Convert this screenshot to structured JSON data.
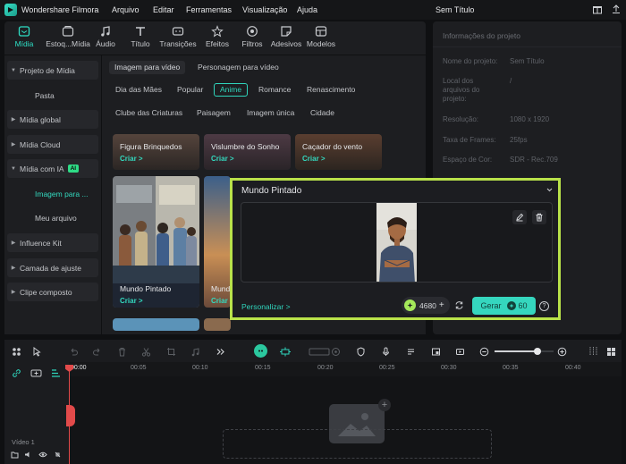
{
  "app": {
    "name": "Wondershare Filmora",
    "menu": [
      "Arquivo",
      "Editar",
      "Ferramentas",
      "Visualização",
      "Ajuda"
    ],
    "project_title": "Sem Título"
  },
  "toolbar": {
    "tabs": [
      {
        "label": "Mídia",
        "icon": "media-icon",
        "active": true
      },
      {
        "label": "Estoq...Mídia",
        "icon": "stock-media-icon"
      },
      {
        "label": "Áudio",
        "icon": "music-note-icon"
      },
      {
        "label": "Título",
        "icon": "text-t-icon"
      },
      {
        "label": "Transições",
        "icon": "transitions-icon"
      },
      {
        "label": "Efeitos",
        "icon": "effects-icon"
      },
      {
        "label": "Filtros",
        "icon": "filters-icon"
      },
      {
        "label": "Adesivos",
        "icon": "stickers-icon"
      },
      {
        "label": "Modelos",
        "icon": "templates-icon"
      }
    ]
  },
  "sidebar": {
    "items": [
      {
        "label": "Projeto de Mídia",
        "type": "group"
      },
      {
        "label": "Pasta",
        "type": "sub"
      },
      {
        "label": "Mídia global",
        "type": "group"
      },
      {
        "label": "Mídia Cloud",
        "type": "group"
      },
      {
        "label": "Mídia com IA",
        "type": "group-open",
        "badge": "AI"
      },
      {
        "label": "Imagem para ...",
        "type": "sub-selected"
      },
      {
        "label": "Meu arquivo",
        "type": "sub"
      },
      {
        "label": "Influence Kit",
        "type": "group"
      },
      {
        "label": "Camada de ajuste",
        "type": "group"
      },
      {
        "label": "Clipe composto",
        "type": "group"
      }
    ]
  },
  "content": {
    "mode_tabs": [
      "Imagem para vídeo",
      "Personagem para vídeo"
    ],
    "filters_row1": [
      "Dia das Mães",
      "Popular",
      "Anime",
      "Romance",
      "Renascimento"
    ],
    "filters_row2": [
      "Clube das Criaturas",
      "Paisagem",
      "Imagem única",
      "Cidade"
    ],
    "selected_filter": "Anime",
    "cards_top": [
      {
        "title": "Figura Brinquedos",
        "action": "Criar >"
      },
      {
        "title": "Vislumbre do Sonho",
        "action": "Criar >"
      },
      {
        "title": "Caçador do vento",
        "action": "Criar >"
      }
    ],
    "card_main": {
      "title": "Mundo Pintado",
      "action": "Criar >"
    },
    "card_partial": {
      "title": "Mund",
      "action": "Criar"
    }
  },
  "popup": {
    "title": "Mundo Pintado",
    "customize": "Personalizar >",
    "credits": "4680",
    "generate_label": "Gerar",
    "generate_cost": "60"
  },
  "properties": {
    "header": "Informações do projeto",
    "rows": [
      {
        "label": "Nome do projeto:",
        "value": "Sem Título"
      },
      {
        "label": "Local dos arquivos do projeto:",
        "value": "/"
      },
      {
        "label": "Resolução:",
        "value": "1080 x 1920"
      },
      {
        "label": "Taxa de Frames:",
        "value": "25fps"
      },
      {
        "label": "Espaço de Cor:",
        "value": "SDR - Rec.709"
      }
    ]
  },
  "timeline": {
    "ticks": [
      "00:00",
      "00:05",
      "00:10",
      "00:15",
      "00:20",
      "00:25",
      "00:30",
      "00:35",
      "00:40"
    ],
    "track_label": "Vídeo 1",
    "zoom_level": 0.72
  },
  "colors": {
    "accent": "#2fd5bc",
    "popup_border": "#b9e24a",
    "badge": "#2edc86"
  }
}
